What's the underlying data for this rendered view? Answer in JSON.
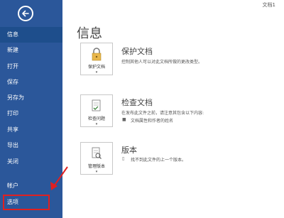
{
  "window": {
    "doc_title": "文档1"
  },
  "sidebar": {
    "items": [
      {
        "label": "信息"
      },
      {
        "label": "新建"
      },
      {
        "label": "打开"
      },
      {
        "label": "保存"
      },
      {
        "label": "另存为"
      },
      {
        "label": "打印"
      },
      {
        "label": "共享"
      },
      {
        "label": "导出"
      },
      {
        "label": "关闭"
      },
      {
        "label": "帐户"
      },
      {
        "label": "选项"
      }
    ]
  },
  "main": {
    "title": "信息",
    "sections": [
      {
        "tile_label": "保护文档",
        "heading": "保护文档",
        "description": "控制其他人可以对此文档所做的更改类型。"
      },
      {
        "tile_label": "检查问题",
        "heading": "检查文档",
        "description": "在发布此文件之前，请注意其包含以下内容:",
        "bullets": [
          "文档属性和作者的姓名"
        ]
      },
      {
        "tile_label": "管理版本",
        "heading": "版本",
        "description": "找不到此文件的上一个版本。"
      }
    ]
  },
  "colors": {
    "sidebar_bg": "#2b579a",
    "highlight": "#e02020"
  }
}
